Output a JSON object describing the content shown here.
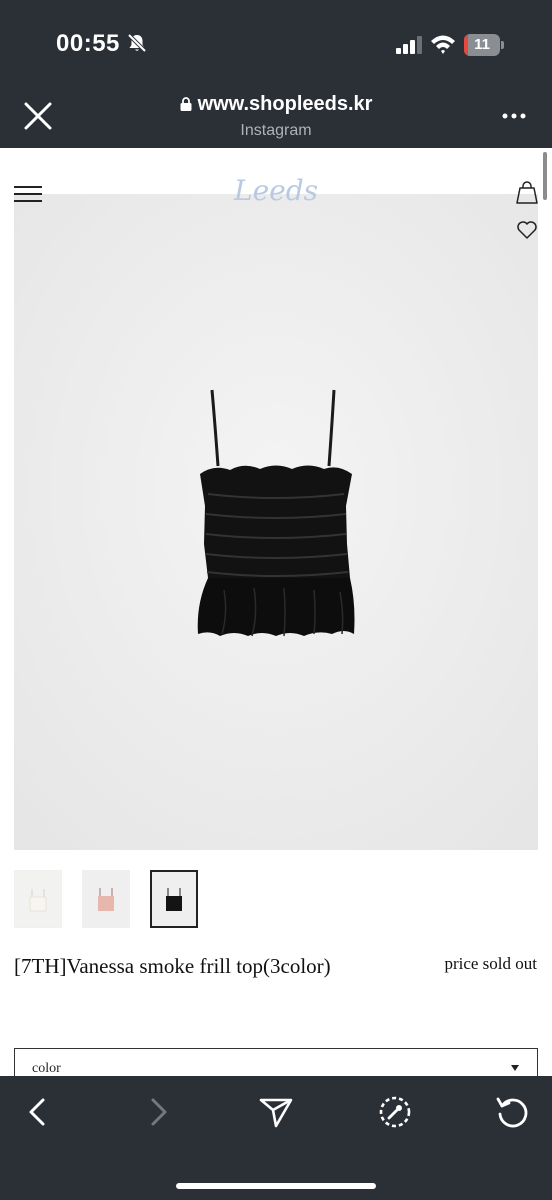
{
  "status": {
    "time": "00:55",
    "battery": "11",
    "battery_percent": 11,
    "battery_color": "#e5483c"
  },
  "browser": {
    "url": "www.shopleeds.kr",
    "source": "Instagram"
  },
  "site": {
    "logo": "Leeds",
    "logo_color": "#b9c9e2"
  },
  "product": {
    "title": "[7TH]Vanessa smoke frill top(3color)",
    "price": "price sold out",
    "thumbnails": [
      {
        "color": "ivory",
        "selected": false
      },
      {
        "color": "pink",
        "selected": false
      },
      {
        "color": "black",
        "selected": true
      }
    ],
    "option": {
      "label": "color"
    }
  },
  "icons": {
    "close": "close-icon",
    "lock": "lock-icon",
    "more": "more-icon",
    "menu": "hamburger-menu-icon",
    "cart": "shopping-bag-icon",
    "wishlist": "heart-icon",
    "back": "chevron-left-icon",
    "forward": "chevron-right-icon",
    "share": "send-icon",
    "open_in_browser": "compass-icon",
    "reload": "reload-icon"
  }
}
